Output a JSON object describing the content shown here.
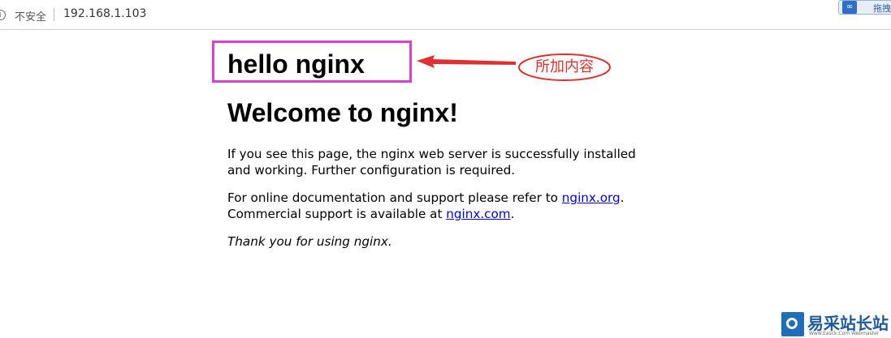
{
  "browser": {
    "security_label": "不安全",
    "url": "192.168.1.103",
    "extension_label": "拖拽"
  },
  "page": {
    "hello_heading": "hello nginx",
    "welcome_heading": "Welcome to nginx!",
    "paragraph1": "If you see this page, the nginx web server is successfully installed and working. Further configuration is required.",
    "paragraph2_prefix": "For online documentation and support please refer to ",
    "link_org": "nginx.org",
    "paragraph2_mid": ".",
    "paragraph2_second_line_prefix": "Commercial support is available at ",
    "link_com": "nginx.com",
    "paragraph2_suffix": ".",
    "thanks": "Thank you for using nginx."
  },
  "annotation": {
    "label": "所加内容",
    "color": "#e03030",
    "box_color": "#d83fd8"
  },
  "watermark": {
    "title": "易采站长站",
    "subtitle": "Www.Easck.Com Webmaster"
  }
}
